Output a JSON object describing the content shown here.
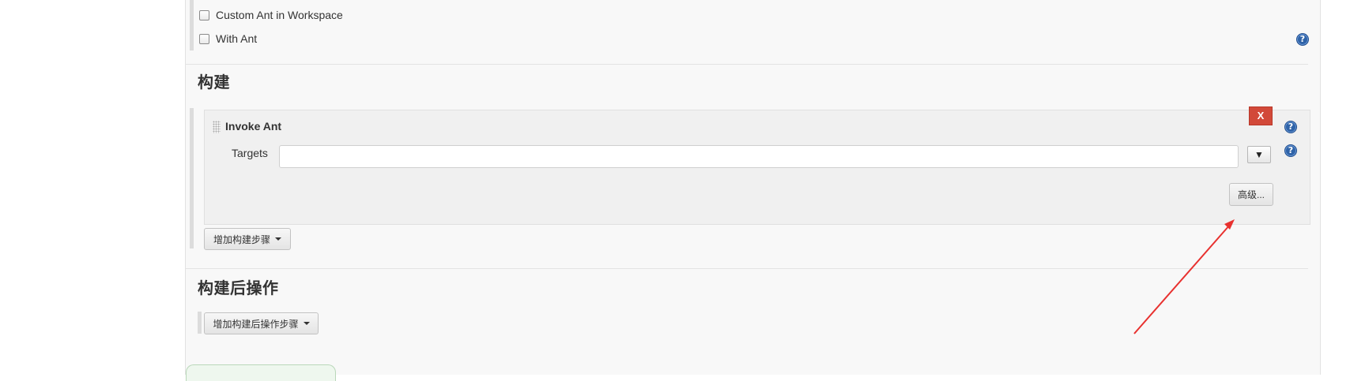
{
  "build_env": {
    "checkbox_custom_ant_label": "Custom Ant in Workspace",
    "checkbox_with_ant_label": "With Ant",
    "help_glyph": "?"
  },
  "build": {
    "section_title": "构建",
    "step": {
      "title": "Invoke Ant",
      "delete_label": "X",
      "targets_label": "Targets",
      "targets_value": "",
      "expand_glyph": "▼",
      "advanced_label": "高级..."
    },
    "add_step_label": "增加构建步骤"
  },
  "post_build": {
    "section_title": "构建后操作",
    "add_step_label": "增加构建后操作步骤"
  },
  "colors": {
    "panel_bg": "#f8f8f8",
    "step_bg": "#f0f0f0",
    "delete_red": "#d24939",
    "help_blue": "#2f63a8",
    "annotation_arrow": "#e8312f"
  },
  "icons": {
    "help": "help-icon",
    "drag": "drag-handle-icon",
    "dropdown": "caret-down-icon",
    "arrow": "annotation-arrow"
  }
}
